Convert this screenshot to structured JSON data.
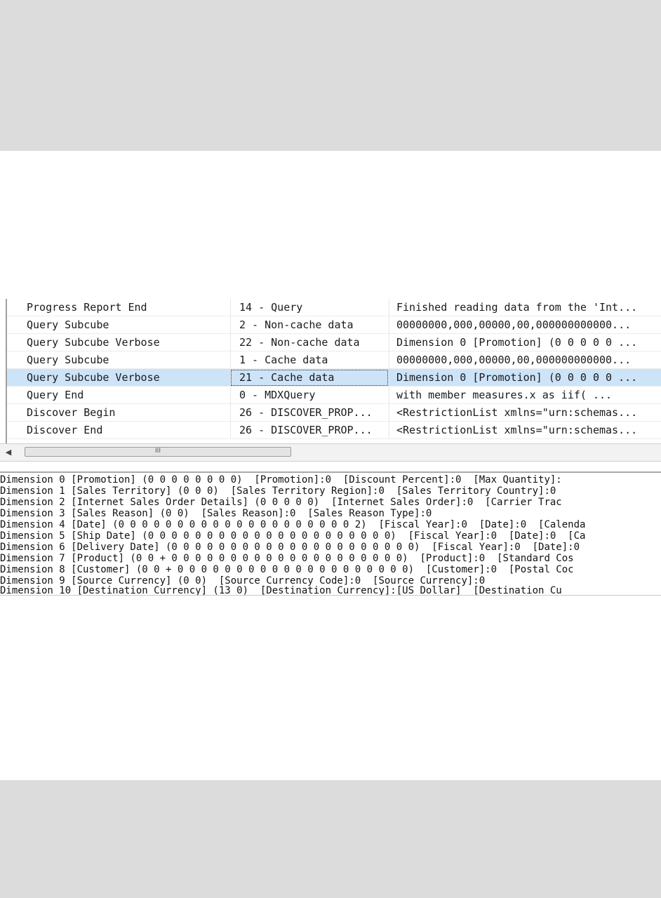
{
  "trace_grid": {
    "rows": [
      {
        "event": "Progress Report End",
        "subclass": "14 - Query",
        "text": "Finished reading data from the 'Int..."
      },
      {
        "event": "Query Subcube",
        "subclass": "2 - Non-cache data",
        "text": "00000000,000,00000,00,000000000000..."
      },
      {
        "event": "Query Subcube Verbose",
        "subclass": "22 - Non-cache data",
        "text": "Dimension 0 [Promotion] (0 0 0 0 0 ..."
      },
      {
        "event": "Query Subcube",
        "subclass": "1 - Cache data",
        "text": "00000000,000,00000,00,000000000000..."
      },
      {
        "event": "Query Subcube Verbose",
        "subclass": "21 - Cache data",
        "text": "Dimension 0 [Promotion] (0 0 0 0 0 ..."
      },
      {
        "event": "Query End",
        "subclass": "0 - MDXQuery",
        "text": "with member measures.x as  iif(    ..."
      },
      {
        "event": "Discover Begin",
        "subclass": "26 - DISCOVER_PROP...",
        "text": "<RestrictionList xmlns=\"urn:schemas..."
      },
      {
        "event": "Discover End",
        "subclass": "26 - DISCOVER_PROP...",
        "text": "<RestrictionList xmlns=\"urn:schemas..."
      }
    ],
    "selected_index": 4
  },
  "scrollbar": {
    "left_arrow_icon": "left-arrow-icon",
    "thumb_grip": "III"
  },
  "detail_text": {
    "lines": [
      "Dimension 0 [Promotion] (0 0 0 0 0 0 0 0)  [Promotion]:0  [Discount Percent]:0  [Max Quantity]:",
      "Dimension 1 [Sales Territory] (0 0 0)  [Sales Territory Region]:0  [Sales Territory Country]:0",
      "Dimension 2 [Internet Sales Order Details] (0 0 0 0 0)  [Internet Sales Order]:0  [Carrier Trac",
      "Dimension 3 [Sales Reason] (0 0)  [Sales Reason]:0  [Sales Reason Type]:0",
      "Dimension 4 [Date] (0 0 0 0 0 0 0 0 0 0 0 0 0 0 0 0 0 0 0 0 2)  [Fiscal Year]:0  [Date]:0  [Calenda",
      "Dimension 5 [Ship Date] (0 0 0 0 0 0 0 0 0 0 0 0 0 0 0 0 0 0 0 0 0)  [Fiscal Year]:0  [Date]:0  [Ca",
      "Dimension 6 [Delivery Date] (0 0 0 0 0 0 0 0 0 0 0 0 0 0 0 0 0 0 0 0 0)  [Fiscal Year]:0  [Date]:0",
      "Dimension 7 [Product] (0 0 + 0 0 0 0 0 0 0 0 0 0 0 0 0 0 0 0 0 0 0 0)  [Product]:0  [Standard Cos",
      "Dimension 8 [Customer] (0 0 + 0 0 0 0 0 0 0 0 0 0 0 0 0 0 0 0 0 0 0 0)  [Customer]:0  [Postal Coc",
      "Dimension 9 [Source Currency] (0 0)  [Source Currency Code]:0  [Source Currency]:0",
      "Dimension 10 [Destination Currency] (13 0)  [Destination Currency]:[US Dollar]  [Destination Cu"
    ]
  },
  "colors": {
    "selection": "#cce3f8",
    "background_band": "#dcdcdc"
  }
}
